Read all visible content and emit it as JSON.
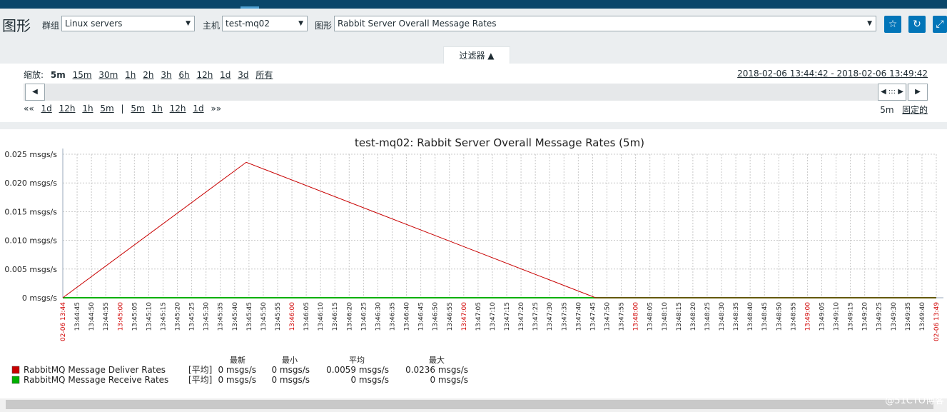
{
  "page": {
    "title": "图形"
  },
  "filters": {
    "group_label": "群组",
    "group_value": "Linux servers",
    "host_label": "主机",
    "host_value": "test-mq02",
    "graph_label": "图形",
    "graph_value": "Rabbit Server Overall Message Rates"
  },
  "icons": {
    "favorite": "star-icon",
    "refresh": "refresh-icon",
    "fullscreen": "fullscreen-icon"
  },
  "filter_tab": "过滤器 ▲",
  "zoom": {
    "label": "缩放:",
    "options": [
      "5m",
      "15m",
      "30m",
      "1h",
      "2h",
      "3h",
      "6h",
      "12h",
      "1d",
      "3d",
      "所有"
    ],
    "active": "5m"
  },
  "time_range": "2018-02-06 13:44:42 - 2018-02-06 13:49:42",
  "periods": {
    "back": "««",
    "back_options": [
      "1d",
      "12h",
      "1h",
      "5m"
    ],
    "sep": "|",
    "fwd_options": [
      "5m",
      "1h",
      "12h",
      "1d"
    ],
    "fwd": "»»"
  },
  "period_status": {
    "value": "5m",
    "fixed": "固定的"
  },
  "nav": {
    "left": "◀",
    "mid": "◀ ::: ▶",
    "right": "▶"
  },
  "chart_data": {
    "type": "line",
    "title": "test-mq02: Rabbit Server Overall Message Rates (5m)",
    "y_ticks": [
      "0.025 msgs/s",
      "0.020 msgs/s",
      "0.015 msgs/s",
      "0.010 msgs/s",
      "0.005 msgs/s",
      "0 msgs/s"
    ],
    "ylim": [
      0,
      0.025
    ],
    "x_ticks": [
      "02-06 13:44",
      "13:44:45",
      "13:44:50",
      "13:44:55",
      "13:45:00",
      "13:45:05",
      "13:45:10",
      "13:45:15",
      "13:45:20",
      "13:45:25",
      "13:45:30",
      "13:45:35",
      "13:45:40",
      "13:45:45",
      "13:45:50",
      "13:45:55",
      "13:46:00",
      "13:46:05",
      "13:46:10",
      "13:46:15",
      "13:46:20",
      "13:46:25",
      "13:46:30",
      "13:46:35",
      "13:46:40",
      "13:46:45",
      "13:46:50",
      "13:46:55",
      "13:47:00",
      "13:47:05",
      "13:47:10",
      "13:47:15",
      "13:47:20",
      "13:47:25",
      "13:47:30",
      "13:47:35",
      "13:47:40",
      "13:47:45",
      "13:47:50",
      "13:47:55",
      "13:48:00",
      "13:48:05",
      "13:48:10",
      "13:48:15",
      "13:48:20",
      "13:48:25",
      "13:48:30",
      "13:48:35",
      "13:48:40",
      "13:48:45",
      "13:48:50",
      "13:48:55",
      "13:49:00",
      "13:49:05",
      "13:49:10",
      "13:49:15",
      "13:49:20",
      "13:49:25",
      "13:49:30",
      "13:49:35",
      "13:49:40",
      "02-06 13:49"
    ],
    "red_ticks": [
      "02-06 13:44",
      "13:45:00",
      "13:46:00",
      "13:47:00",
      "13:48:00",
      "13:49:00",
      "02-06 13:49"
    ],
    "series": [
      {
        "name": "RabbitMQ Message Deliver Rates",
        "color": "#c80000",
        "x": [
          "13:44:42",
          "13:45:45",
          "13:47:45",
          "13:49:42"
        ],
        "y": [
          0,
          0.0236,
          0,
          0
        ],
        "stats": {
          "tag": "[平均]",
          "last": "0 msgs/s",
          "min": "0 msgs/s",
          "avg": "0.0059 msgs/s",
          "max": "0.0236 msgs/s"
        }
      },
      {
        "name": "RabbitMQ Message Receive Rates",
        "color": "#00b000",
        "x": [
          "13:44:42",
          "13:49:42"
        ],
        "y": [
          0,
          0
        ],
        "stats": {
          "tag": "[平均]",
          "last": "0 msgs/s",
          "min": "0 msgs/s",
          "avg": "0 msgs/s",
          "max": "0 msgs/s"
        }
      }
    ],
    "legend_headers": [
      "最新",
      "最小",
      "平均",
      "最大"
    ]
  },
  "watermark": "@51CTO博客"
}
